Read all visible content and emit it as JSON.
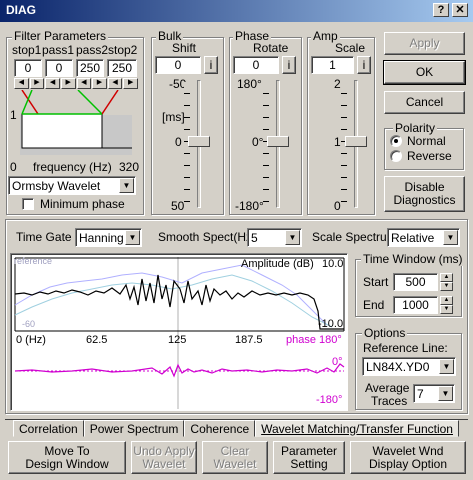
{
  "window": {
    "title": "DIAG",
    "help_glyph": "?",
    "close_glyph": "✕"
  },
  "filter": {
    "group": "Filter Parameters",
    "labels": [
      "stop1",
      "pass1",
      "pass2",
      "stop2"
    ],
    "values": [
      "0",
      "0",
      "250",
      "250"
    ],
    "plot_one": "1",
    "plot_zero": "0",
    "freq_label": "frequency  (Hz)",
    "freq_max": "320",
    "wavelet": "Ormsby Wavelet",
    "min_phase": "Minimum phase"
  },
  "bulk": {
    "group": "Bulk",
    "label": "Shift",
    "value": "0",
    "info": "i",
    "scale": [
      "-50",
      "[ms]",
      "0",
      "50"
    ]
  },
  "phase": {
    "group": "Phase",
    "label": "Rotate",
    "value": "0",
    "info": "i",
    "scale": [
      "180°",
      "0°",
      "-180°"
    ]
  },
  "amp": {
    "group": "Amp",
    "label": "Scale",
    "value": "1",
    "info": "i",
    "scale": [
      "2",
      "1",
      "0"
    ]
  },
  "buttons": {
    "apply": "Apply",
    "ok": "OK",
    "cancel": "Cancel",
    "disable_line1": "Disable",
    "disable_line2": "Diagnostics"
  },
  "polarity": {
    "group": "Polarity",
    "normal": "Normal",
    "reverse": "Reverse",
    "selected": "Normal"
  },
  "controls": {
    "time_gate_label": "Time Gate",
    "time_gate": "Hanning",
    "smooth_label": "Smooth Spect(Hz)",
    "smooth": "5",
    "scale_label": "Scale Spectrum",
    "scale": "Relative"
  },
  "plot": {
    "amp_title": "Amplitude (dB)",
    "amp_top": "10.0",
    "amp_bot": "-10.0",
    "ref_label": "reference",
    "ref_bot": "-60",
    "x_ticks": [
      "0 (Hz)",
      "62.5",
      "125",
      "187.5"
    ],
    "phase_label": "phase",
    "phase_top": "180°",
    "phase_mid": "0°",
    "phase_bot": "-180°"
  },
  "time_window": {
    "group": "Time Window (ms)",
    "start_label": "Start",
    "start": "500",
    "end_label": "End",
    "end": "1000"
  },
  "options": {
    "group": "Options",
    "ref_label": "Reference Line:",
    "ref_value": "LN84X.YD0",
    "avg_line1": "Average",
    "avg_line2": "Traces",
    "avg_value": "7"
  },
  "tabs": [
    "Correlation",
    "Power Spectrum",
    "Coherence",
    "Wavelet Matching/Transfer Function"
  ],
  "active_tab": "Wavelet Matching/Transfer Function",
  "bottom": {
    "move_1": "Move To",
    "move_2": "Design Window",
    "undo_1": "Undo Apply",
    "undo_2": "Wavelet",
    "clear_1": "Clear",
    "clear_2": "Wavelet",
    "param_1": "Parameter",
    "param_2": "Setting",
    "wnd_1": "Wavelet Wnd",
    "wnd_2": "Display Option"
  },
  "colors": {
    "amp": "#000000",
    "ref1": "#b0b0ff",
    "ref2": "#a0d0e0",
    "phase": "#d000d0",
    "dim_axis": "#d000d0",
    "filter_lines": "#00c000",
    "filter_red": "#d00000"
  }
}
